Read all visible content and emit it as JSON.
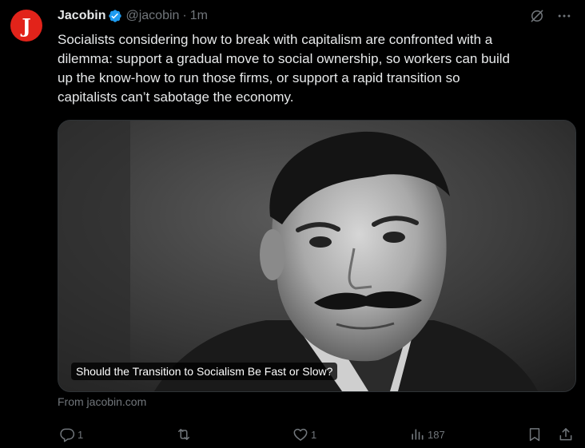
{
  "author": {
    "name": "Jacobin",
    "handle": "@jacobin",
    "separator": "·",
    "time": "1m",
    "avatar_letter": "J",
    "avatar_color": "#e2231a",
    "verified_color": "#1d9bf0"
  },
  "header_icons": [
    "grok-icon",
    "more-icon"
  ],
  "tweet": {
    "text": "Socialists considering how to break with capitalism are confronted with a\ndilemma: support a gradual move to social ownership, so workers can build\nup the know-how to run those firms, or support a rapid transition so\ncapitalists can’t sabotage the economy."
  },
  "card": {
    "title": "Should the Transition to Socialism Be Fast or Slow?",
    "source": "From jacobin.com",
    "image": "black-and-white portrait photo"
  },
  "actions": {
    "reply_count": "1",
    "retweet_count": "",
    "like_count": "1",
    "views_count": "187"
  },
  "colors": {
    "background": "#000000",
    "text": "#e7e9ea",
    "muted": "#71767b",
    "border": "#2f3336"
  }
}
